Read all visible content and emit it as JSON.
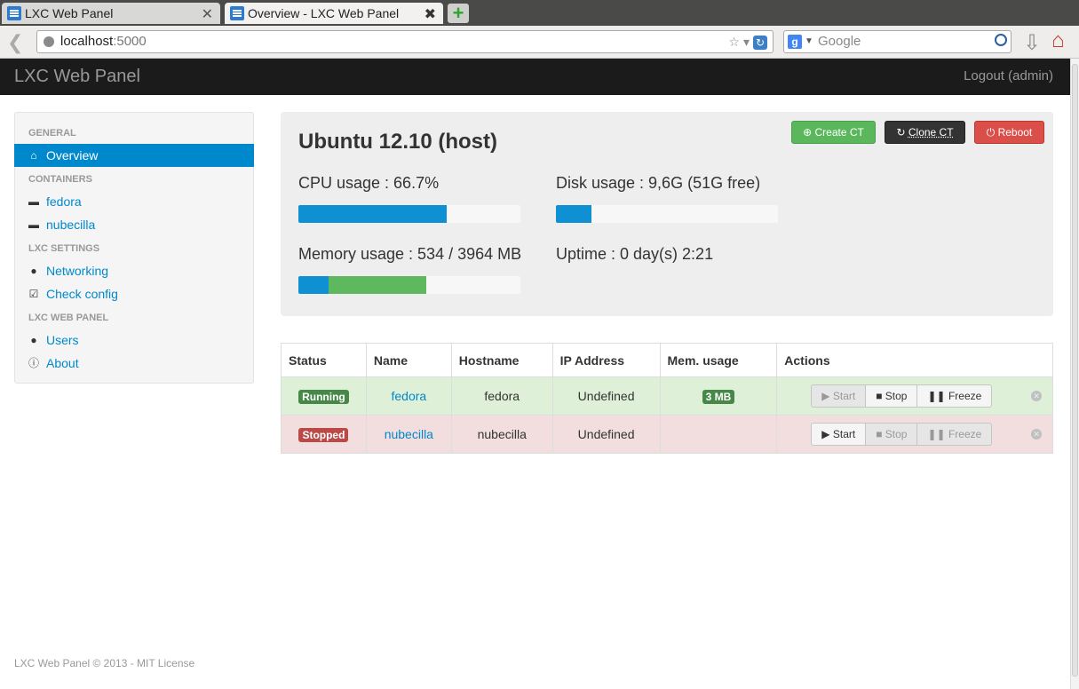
{
  "browser": {
    "tabs": [
      {
        "title": "LXC Web Panel",
        "active": false
      },
      {
        "title": "Overview - LXC Web Panel",
        "active": true
      }
    ],
    "url_host": "localhost",
    "url_port": ":5000",
    "search_placeholder": "Google"
  },
  "app": {
    "brand": "LXC Web Panel",
    "logout": "Logout (admin)"
  },
  "sidebar": {
    "headers": [
      "GENERAL",
      "CONTAINERS",
      "LXC SETTINGS",
      "LXC WEB PANEL"
    ],
    "items": [
      {
        "label": "Overview",
        "icon": "home-icon",
        "active": true
      },
      {
        "label": "fedora",
        "icon": "drive-icon"
      },
      {
        "label": "nubecilla",
        "icon": "drive-icon"
      },
      {
        "label": "Networking",
        "icon": "globe-icon"
      },
      {
        "label": "Check config",
        "icon": "check-icon"
      },
      {
        "label": "Users",
        "icon": "user-icon"
      },
      {
        "label": "About",
        "icon": "info-icon"
      }
    ]
  },
  "host": {
    "title": "Ubuntu 12.10 (host)",
    "buttons": {
      "create": "Create CT",
      "clone": "Clone CT",
      "reboot": "Reboot"
    },
    "cpu_label": "CPU usage : 66.7%",
    "disk_label": "Disk usage : 9,6G (51G free)",
    "memory_label": "Memory usage : 534 / 3964 MB",
    "uptime_label": "Uptime : 0 day(s) 2:21",
    "cpu_fraction": 0.667,
    "disk_fraction": 0.16,
    "memory_used_fraction": 0.135,
    "memory_cached_fraction": 0.44
  },
  "colors": {
    "primary": "#0088cc",
    "success": "#5bb75b",
    "danger": "#da4f49",
    "dark": "#333333"
  },
  "table": {
    "headers": [
      "Status",
      "Name",
      "Hostname",
      "IP Address",
      "Mem. usage",
      "Actions"
    ],
    "rows": [
      {
        "status": "Running",
        "name": "fedora",
        "hostname": "fedora",
        "ip": "Undefined",
        "mem": "3 MB"
      },
      {
        "status": "Stopped",
        "name": "nubecilla",
        "hostname": "nubecilla",
        "ip": "Undefined",
        "mem": ""
      }
    ],
    "actions": {
      "start": "Start",
      "stop": "Stop",
      "freeze": "Freeze"
    }
  },
  "footer": "LXC Web Panel © 2013 - MIT License"
}
